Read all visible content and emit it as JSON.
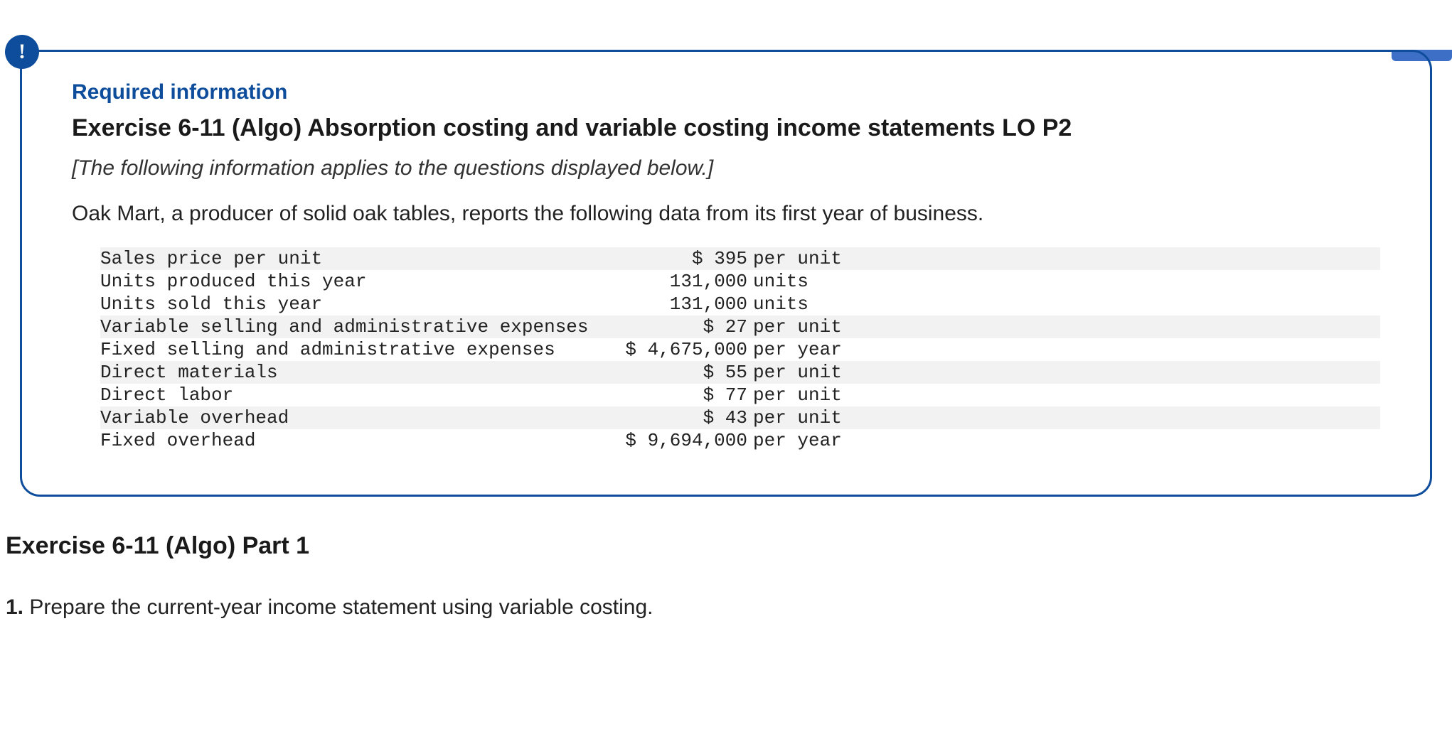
{
  "info_badge": "!",
  "required_label": "Required information",
  "exercise_title": "Exercise 6-11 (Algo) Absorption costing and variable costing income statements LO P2",
  "italic_note": "[The following information applies to the questions displayed below.]",
  "intro_text": "Oak Mart, a producer of solid oak tables, reports the following data from its first year of business.",
  "data_rows": [
    {
      "label": "Sales price per unit",
      "amount": "$ 395",
      "unit": "per unit",
      "shade": true
    },
    {
      "label": "Units produced this year",
      "amount": "131,000",
      "unit": "units",
      "shade": false
    },
    {
      "label": "Units sold this year",
      "amount": "131,000",
      "unit": "units",
      "shade": false
    },
    {
      "label": "Variable selling and administrative expenses",
      "amount": "$ 27",
      "unit": "per unit",
      "shade": true
    },
    {
      "label": "Fixed selling and administrative expenses",
      "amount": "$ 4,675,000",
      "unit": "per year",
      "shade": false
    },
    {
      "label": "Direct materials",
      "amount": "$ 55",
      "unit": "per unit",
      "shade": true
    },
    {
      "label": "Direct labor",
      "amount": "$ 77",
      "unit": "per unit",
      "shade": false
    },
    {
      "label": "Variable overhead",
      "amount": "$ 43",
      "unit": "per unit",
      "shade": true
    },
    {
      "label": "Fixed overhead",
      "amount": "$ 9,694,000",
      "unit": "per year",
      "shade": false
    }
  ],
  "part_title": "Exercise 6-11 (Algo) Part 1",
  "instruction_num": "1.",
  "instruction_text": " Prepare the current-year income statement using variable costing."
}
